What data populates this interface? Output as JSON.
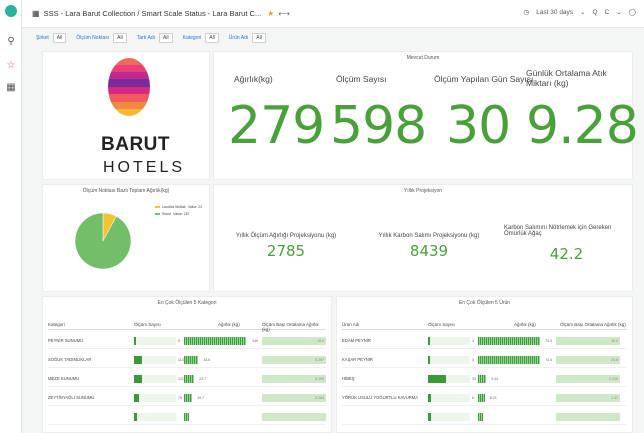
{
  "topbar": {
    "breadcrumb": "SSS - Lara Barut Collection / Smart Scale Status - Lara Barut C...",
    "time_range": "Last 30 days",
    "zoom_label": "Q",
    "refresh_label": "C"
  },
  "filters": [
    {
      "label": "Şirket",
      "value": "All"
    },
    {
      "label": "Ölçüm Noktası",
      "value": "All"
    },
    {
      "label": "Tartı Adı",
      "value": "All"
    },
    {
      "label": "Kategori",
      "value": "All"
    },
    {
      "label": "Ürün Adı",
      "value": "All"
    }
  ],
  "logo": {
    "brand": "BARUT",
    "sub": "HOTELS"
  },
  "current_status": {
    "title": "Mevcut Durum",
    "stats": [
      {
        "label": "Ağırlık(kg)",
        "value": "279"
      },
      {
        "label": "Ölçüm Sayısı",
        "value": "598"
      },
      {
        "label": "Ölçüm Yapılan Gün Sayısı",
        "value": "30"
      },
      {
        "label": "Günlük Ortalama Atık Miktarı (kg)",
        "value": "9.28"
      }
    ]
  },
  "pie": {
    "title": "Ölçüm Noktası Bazlı Toplam Ağırlık(kg)",
    "legend": [
      {
        "name": "Landiva Mutfak",
        "value": "Value: 22",
        "color": "#f4c430"
      },
      {
        "name": "Stone",
        "value": "Value: 257",
        "color": "#73bf69"
      }
    ]
  },
  "chart_data": {
    "type": "pie",
    "title": "Ölçüm Noktası Bazlı Toplam Ağırlık(kg)",
    "series": [
      {
        "name": "Landiva Mutfak",
        "value": 22
      },
      {
        "name": "Stone",
        "value": 257
      }
    ]
  },
  "yearly": {
    "title": "Yıllık Projeksiyon",
    "stats": [
      {
        "label": "Yıllık Ölçüm Ağırlığı Projeksiyonu (kg)",
        "value": "2785"
      },
      {
        "label": "Yıllık Karbon Salımı Projeksiyonu (kg)",
        "value": "8439"
      },
      {
        "label": "Karbon Salımını Nötrlemek için Gereken Ömürlük Ağaç",
        "value": "42.2"
      }
    ]
  },
  "left_table": {
    "title": "En Çok Ölçülen 5 Kategori",
    "headers": [
      "Kategori",
      "Ölçüm Sayısı",
      "Ağırlık (kg)",
      "Ölçüm Başı Ortalama Ağırlık (kg)"
    ],
    "rows": [
      {
        "name": "PEYNİR SUNUMU",
        "count": "5",
        "count_frac": 0.04,
        "weight": "149",
        "weight_frac": 1.0,
        "avg": "19.6"
      },
      {
        "name": "SOĞUK TADIMLIKLAR",
        "count": "113",
        "count_frac": 0.19,
        "weight": "33.6",
        "weight_frac": 0.23,
        "avg": "0.297"
      },
      {
        "name": "MEZE SUNUMU",
        "count": "121",
        "count_frac": 0.2,
        "weight": "23.7",
        "weight_frac": 0.16,
        "avg": "0.196"
      },
      {
        "name": "ZEYTİNYAĞLI SUNUMU",
        "count": "75",
        "count_frac": 0.13,
        "weight": "19.7",
        "weight_frac": 0.13,
        "avg": "0.263"
      },
      {
        "name": "",
        "count": "",
        "count_frac": 0.08,
        "weight": "",
        "weight_frac": 0.08,
        "avg": ""
      }
    ]
  },
  "right_table": {
    "title": "En Çok Ölçülen 5 Ürün",
    "headers": [
      "Ürün Adı",
      "Ölçüm Sayısı",
      "Ağırlık (kg)",
      "Ölçüm Başı Ortalama Ağırlık (kg)"
    ],
    "rows": [
      {
        "name": "EDAM PEYNİR",
        "count": "3",
        "count_frac": 0.04,
        "weight": "74.4",
        "weight_frac": 1.0,
        "avg": "19.9"
      },
      {
        "name": "KAŞAR PEYNİR",
        "count": "3",
        "count_frac": 0.04,
        "weight": "74.4",
        "weight_frac": 1.0,
        "avg": "24.8"
      },
      {
        "name": "HİBEŞ",
        "count": "30",
        "count_frac": 0.42,
        "weight": "9.44",
        "weight_frac": 0.13,
        "avg": "0.315"
      },
      {
        "name": "YÖRÜK USULÜ YOĞURTLU KAVURMA",
        "count": "6",
        "count_frac": 0.08,
        "weight": "8.21",
        "weight_frac": 0.11,
        "avg": "1.37"
      },
      {
        "name": "",
        "count": "",
        "count_frac": 0.08,
        "weight": "",
        "weight_frac": 0.08,
        "avg": ""
      }
    ]
  }
}
